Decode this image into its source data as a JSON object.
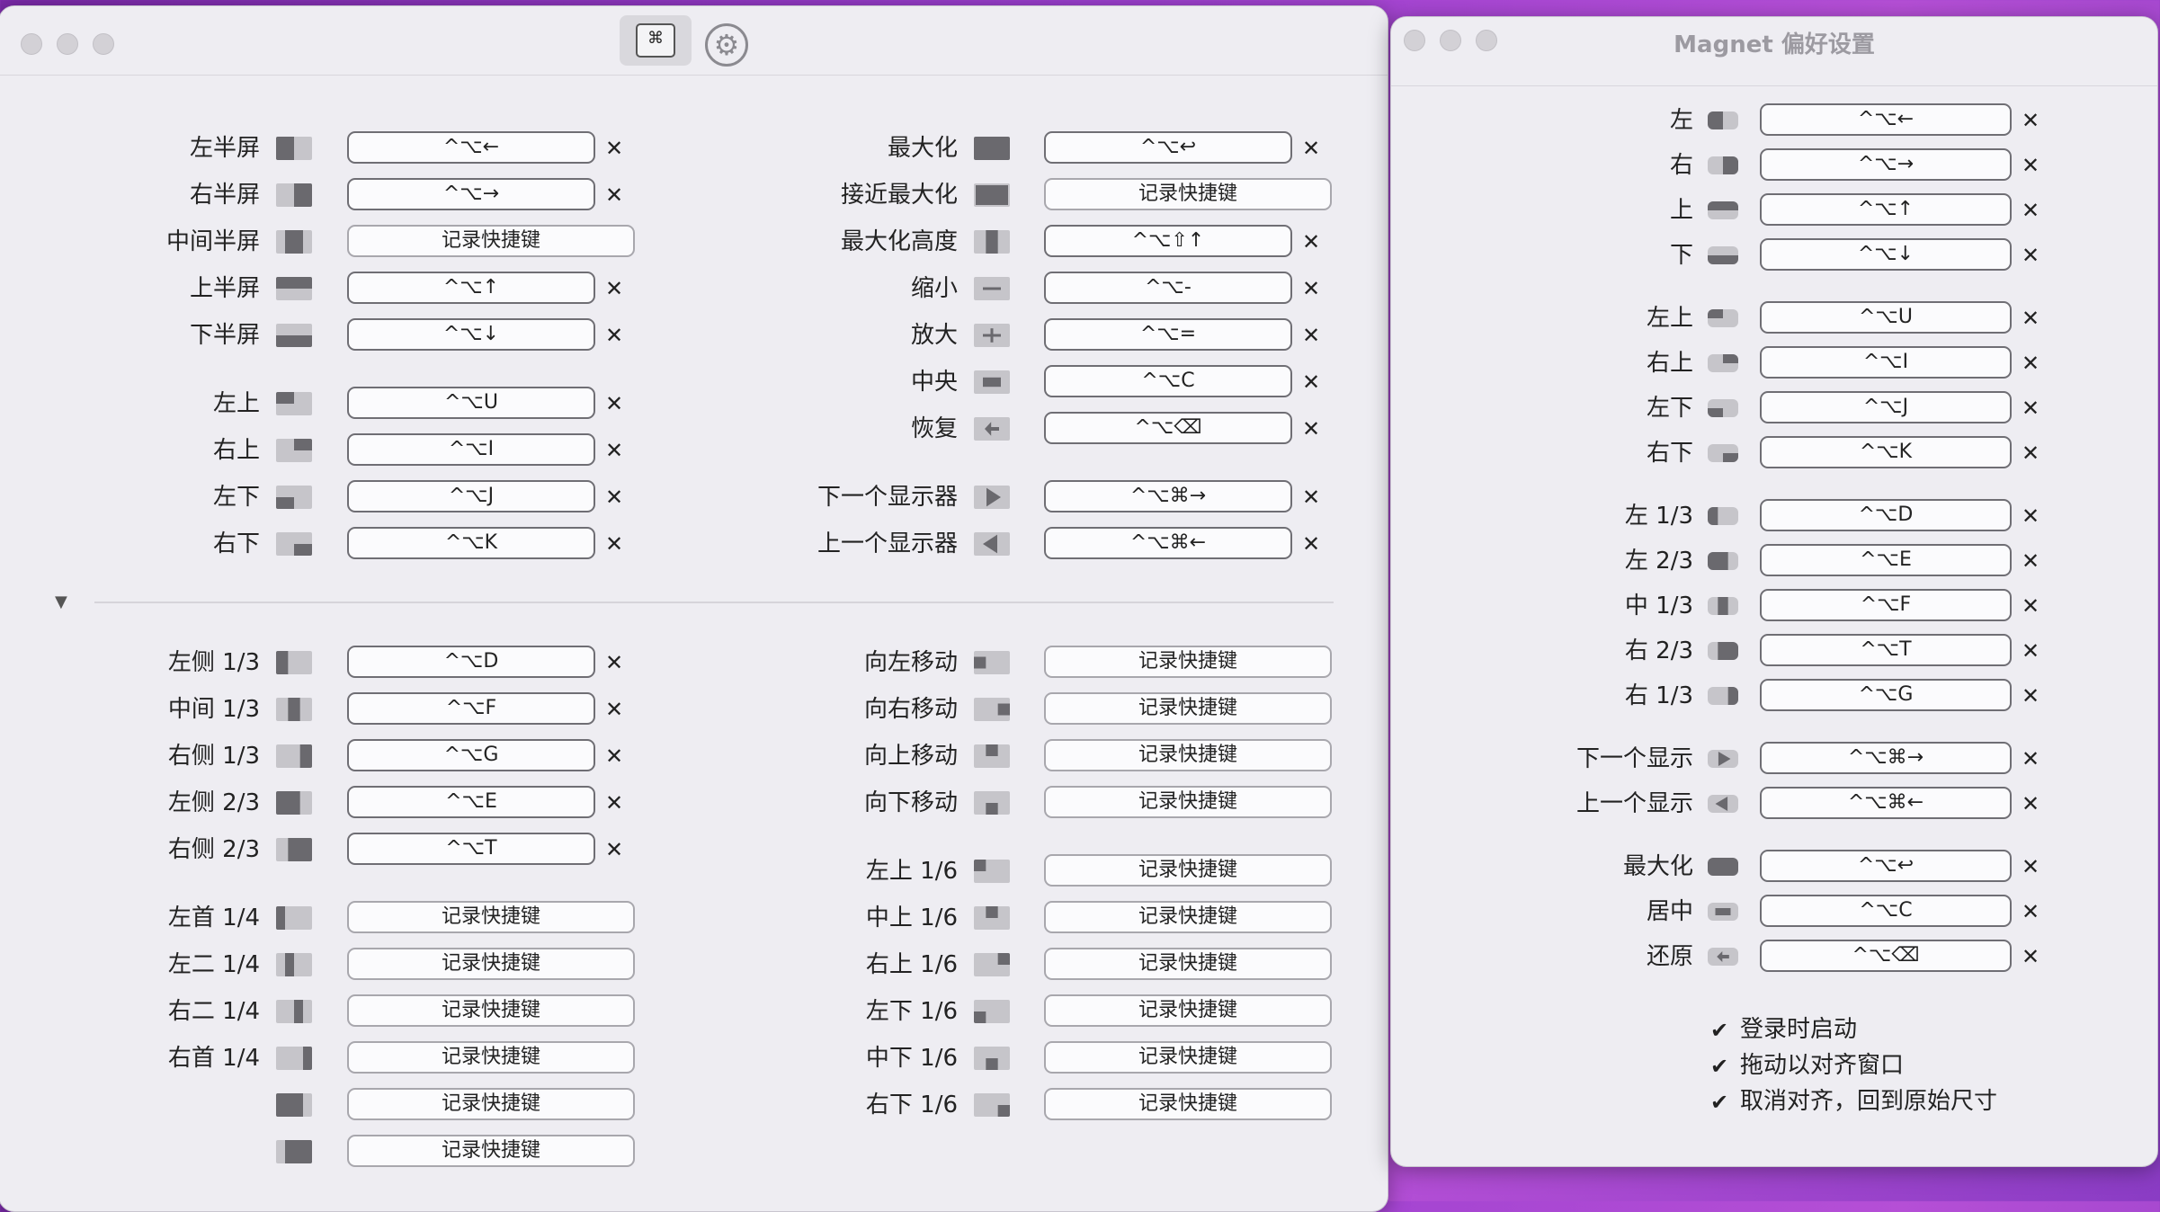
{
  "main_window": {
    "left_top": [
      {
        "label": "左半屏",
        "shortcut": "^⌥←",
        "icon": "left-half-icon"
      },
      {
        "label": "右半屏",
        "shortcut": "^⌥→",
        "icon": "right-half-icon"
      },
      {
        "label": "中间半屏",
        "shortcut": "记录快捷键",
        "icon": "center-half-icon",
        "empty": true
      },
      {
        "label": "上半屏",
        "shortcut": "^⌥↑",
        "icon": "top-half-icon"
      },
      {
        "label": "下半屏",
        "shortcut": "^⌥↓",
        "icon": "bottom-half-icon"
      },
      {
        "label": "左上",
        "shortcut": "^⌥U",
        "icon": "top-left-icon",
        "gap": true
      },
      {
        "label": "右上",
        "shortcut": "^⌥I",
        "icon": "top-right-icon"
      },
      {
        "label": "左下",
        "shortcut": "^⌥J",
        "icon": "bottom-left-icon"
      },
      {
        "label": "右下",
        "shortcut": "^⌥K",
        "icon": "bottom-right-icon"
      }
    ],
    "right_top": [
      {
        "label": "最大化",
        "shortcut": "^⌥↩",
        "icon": "maximize-icon"
      },
      {
        "label": "接近最大化",
        "shortcut": "记录快捷键",
        "icon": "almost-maximize-icon",
        "empty": true
      },
      {
        "label": "最大化高度",
        "shortcut": "^⌥⇧↑",
        "icon": "maximize-height-icon"
      },
      {
        "label": "缩小",
        "shortcut": "^⌥-",
        "icon": "minus-icon"
      },
      {
        "label": "放大",
        "shortcut": "^⌥=",
        "icon": "plus-icon"
      },
      {
        "label": "中央",
        "shortcut": "^⌥C",
        "icon": "center-icon"
      },
      {
        "label": "恢复",
        "shortcut": "^⌥⌫",
        "icon": "restore-icon"
      },
      {
        "label": "下一个显示器",
        "shortcut": "^⌥⌘→",
        "icon": "next-display-icon",
        "gap": true
      },
      {
        "label": "上一个显示器",
        "shortcut": "^⌥⌘←",
        "icon": "previous-display-icon"
      }
    ],
    "left_bottom": [
      {
        "label": "左侧 1/3",
        "shortcut": "^⌥D",
        "icon": "left-third-icon"
      },
      {
        "label": "中间 1/3",
        "shortcut": "^⌥F",
        "icon": "center-third-icon"
      },
      {
        "label": "右侧 1/3",
        "shortcut": "^⌥G",
        "icon": "right-third-icon"
      },
      {
        "label": "左侧 2/3",
        "shortcut": "^⌥E",
        "icon": "left-two-thirds-icon"
      },
      {
        "label": "右侧 2/3",
        "shortcut": "^⌥T",
        "icon": "right-two-thirds-icon"
      },
      {
        "label": "左首 1/4",
        "shortcut": "记录快捷键",
        "icon": "first-quarter-icon",
        "empty": true,
        "gap": true
      },
      {
        "label": "左二 1/4",
        "shortcut": "记录快捷键",
        "icon": "second-quarter-icon",
        "empty": true
      },
      {
        "label": "右二 1/4",
        "shortcut": "记录快捷键",
        "icon": "third-quarter-icon",
        "empty": true
      },
      {
        "label": "右首 1/4",
        "shortcut": "记录快捷键",
        "icon": "fourth-quarter-icon",
        "empty": true
      },
      {
        "label": "",
        "shortcut": "记录快捷键",
        "icon": "left-three-quarters-icon",
        "empty": true
      },
      {
        "label": "",
        "shortcut": "记录快捷键",
        "icon": "right-three-quarters-icon",
        "empty": true
      }
    ],
    "right_bottom": [
      {
        "label": "向左移动",
        "shortcut": "记录快捷键",
        "icon": "move-left-icon",
        "empty": true
      },
      {
        "label": "向右移动",
        "shortcut": "记录快捷键",
        "icon": "move-right-icon",
        "empty": true
      },
      {
        "label": "向上移动",
        "shortcut": "记录快捷键",
        "icon": "move-up-icon",
        "empty": true
      },
      {
        "label": "向下移动",
        "shortcut": "记录快捷键",
        "icon": "move-down-icon",
        "empty": true
      },
      {
        "label": "左上 1/6",
        "shortcut": "记录快捷键",
        "icon": "top-left-sixth-icon",
        "empty": true,
        "gap": true
      },
      {
        "label": "中上 1/6",
        "shortcut": "记录快捷键",
        "icon": "top-center-sixth-icon",
        "empty": true
      },
      {
        "label": "右上 1/6",
        "shortcut": "记录快捷键",
        "icon": "top-right-sixth-icon",
        "empty": true
      },
      {
        "label": "左下 1/6",
        "shortcut": "记录快捷键",
        "icon": "bottom-left-sixth-icon",
        "empty": true
      },
      {
        "label": "中下 1/6",
        "shortcut": "记录快捷键",
        "icon": "bottom-center-sixth-icon",
        "empty": true
      },
      {
        "label": "右下 1/6",
        "shortcut": "记录快捷键",
        "icon": "bottom-right-sixth-icon",
        "empty": true
      }
    ],
    "toolbar": {
      "shortcut_tab_glyph": "⌘",
      "settings_tab_glyph": "⚙"
    },
    "collapse_glyph": "▼",
    "clear_glyph": "✕"
  },
  "prefs_window": {
    "title": "Magnet 偏好设置",
    "rows": [
      {
        "label": "左",
        "shortcut": "^⌥←",
        "icon": "left-half-icon"
      },
      {
        "label": "右",
        "shortcut": "^⌥→",
        "icon": "right-half-icon"
      },
      {
        "label": "上",
        "shortcut": "^⌥↑",
        "icon": "top-half-icon"
      },
      {
        "label": "下",
        "shortcut": "^⌥↓",
        "icon": "bottom-half-icon"
      },
      {
        "label": "左上",
        "shortcut": "^⌥U",
        "icon": "top-left-icon",
        "gap": true
      },
      {
        "label": "右上",
        "shortcut": "^⌥I",
        "icon": "top-right-icon"
      },
      {
        "label": "左下",
        "shortcut": "^⌥J",
        "icon": "bottom-left-icon"
      },
      {
        "label": "右下",
        "shortcut": "^⌥K",
        "icon": "bottom-right-icon"
      },
      {
        "label": "左 1/3",
        "shortcut": "^⌥D",
        "icon": "left-third-icon",
        "gap": true
      },
      {
        "label": "左 2/3",
        "shortcut": "^⌥E",
        "icon": "left-two-thirds-icon"
      },
      {
        "label": "中 1/3",
        "shortcut": "^⌥F",
        "icon": "center-third-icon"
      },
      {
        "label": "右 2/3",
        "shortcut": "^⌥T",
        "icon": "right-two-thirds-icon"
      },
      {
        "label": "右 1/3",
        "shortcut": "^⌥G",
        "icon": "right-third-icon"
      },
      {
        "label": "下一个显示",
        "shortcut": "^⌥⌘→",
        "icon": "next-display-icon",
        "gap": true
      },
      {
        "label": "上一个显示",
        "shortcut": "^⌥⌘←",
        "icon": "previous-display-icon"
      },
      {
        "label": "最大化",
        "shortcut": "^⌥↩",
        "icon": "maximize-icon",
        "gap": true
      },
      {
        "label": "居中",
        "shortcut": "^⌥C",
        "icon": "center-icon"
      },
      {
        "label": "还原",
        "shortcut": "^⌥⌫",
        "icon": "restore-icon"
      }
    ],
    "checkboxes": [
      {
        "label": "登录时启动",
        "checked": true
      },
      {
        "label": "拖动以对齐窗口",
        "checked": true
      },
      {
        "label": "取消对齐，回到原始尺寸",
        "checked": true
      }
    ],
    "check_glyph": "✔"
  }
}
